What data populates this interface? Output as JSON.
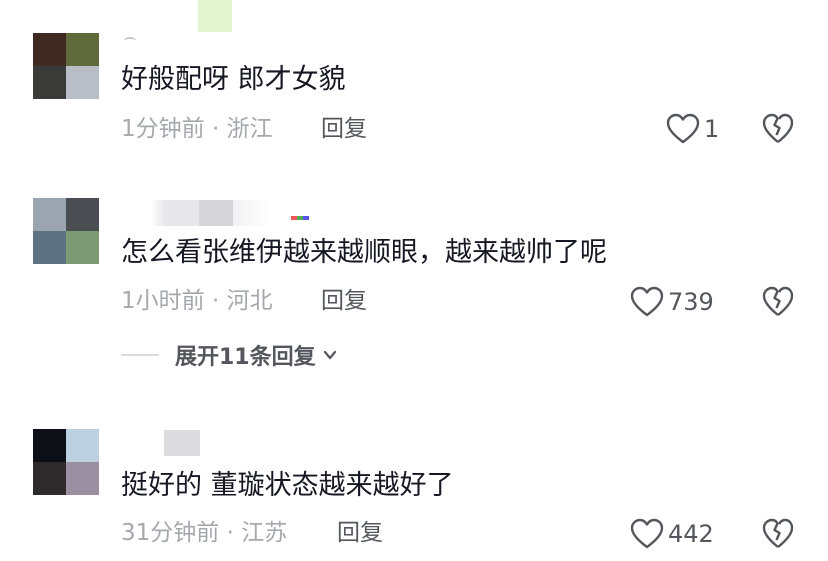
{
  "comments": [
    {
      "text": "好般配呀 郎才女貌",
      "time": "1分钟前",
      "location": "浙江",
      "reply_label": "回复",
      "likes": "1"
    },
    {
      "text": "怎么看张维伊越来越顺眼，越来越帅了呢",
      "time": "1小时前",
      "location": "河北",
      "reply_label": "回复",
      "likes": "739",
      "expand_label": "展开11条回复"
    },
    {
      "text": "挺好的 董璇状态越来越好了",
      "time": "31分钟前",
      "location": "江苏",
      "reply_label": "回复",
      "likes": "442"
    }
  ],
  "separator": "·",
  "icons": {
    "like": "heart-outline-icon",
    "dislike": "broken-heart-icon",
    "expand": "chevron-down-icon"
  },
  "colors": {
    "text": "#161823",
    "meta": "#a7a8ad",
    "secondary": "#55565c"
  }
}
